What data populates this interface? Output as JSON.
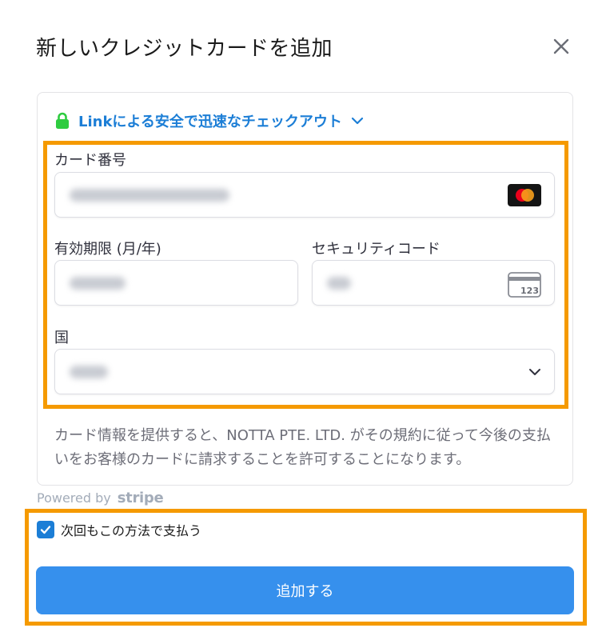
{
  "dialog": {
    "title": "新しいクレジットカードを追加",
    "close_icon": "close-icon"
  },
  "link": {
    "text": "Linkによる安全で迅速なチェックアウト",
    "lock_icon": "lock-icon",
    "lock_color": "#2ecc40",
    "text_color": "#1c7ed6"
  },
  "form": {
    "card_number_label": "カード番号",
    "expiry_label": "有効期限 (月/年)",
    "cvc_label": "セキュリティコード",
    "cvc_icon_text": "123",
    "country_label": "国",
    "card_brand_icon": "mastercard-icon"
  },
  "disclaimer": "カード情報を提供すると、NOTTA PTE. LTD. がその規約に従って今後の支払いをお客様のカードに請求することを許可することになります。",
  "powered": {
    "prefix": "Powered by",
    "brand": "stripe"
  },
  "save_method": {
    "label": "次回もこの方法で支払う",
    "checked": true
  },
  "submit_label": "追加する",
  "colors": {
    "highlight": "#f59a00",
    "primary_button": "#3690ed",
    "checkbox": "#1c7ed6"
  }
}
